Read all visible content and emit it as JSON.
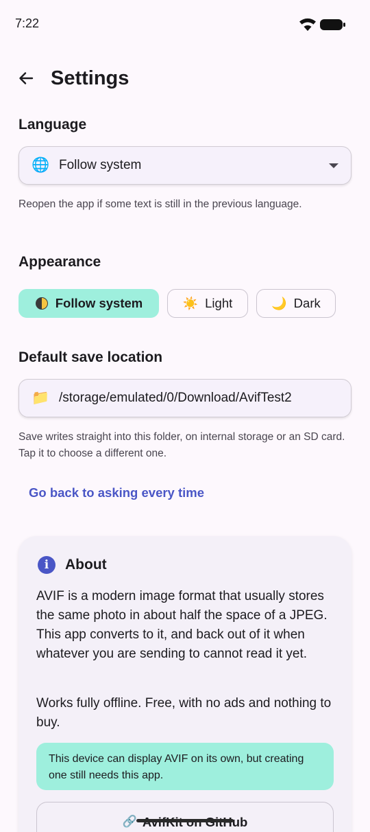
{
  "status_bar": {
    "time": "7:22"
  },
  "header": {
    "title": "Settings"
  },
  "language": {
    "title": "Language",
    "emoji": "🌐",
    "value": "Follow system",
    "helper": "Reopen the app if some text is still in the previous language."
  },
  "appearance": {
    "title": "Appearance",
    "options": [
      {
        "icon": "half-moon-icon",
        "label": "Follow system",
        "selected": true
      },
      {
        "icon": "☀️",
        "label": "Light",
        "selected": false
      },
      {
        "icon": "🌙",
        "label": "Dark",
        "selected": false
      }
    ]
  },
  "save_location": {
    "title": "Default save location",
    "emoji": "📁",
    "value": "/storage/emulated/0/Download/AvifTest2",
    "helper": "Save writes straight into this folder, on internal storage or an SD card. Tap it to choose a different one.",
    "reset_label": "Go back to asking every time"
  },
  "about": {
    "title": "About",
    "paragraph1": "AVIF is a modern image format that usually stores the same photo in about half the space of a JPEG. This app converts to it, and back out of it when whatever you are sending to cannot read it yet.",
    "paragraph2": "Works fully offline. Free, with no ads and nothing to buy.",
    "note": "This device can display AVIF on its own, but creating one still needs this app.",
    "link_icon": "🔗",
    "github_label": "AvifKit on GitHub"
  },
  "colors": {
    "accent": "#4a56c6",
    "chip_selected": "#9eefdd",
    "background": "#fdf8fd"
  }
}
